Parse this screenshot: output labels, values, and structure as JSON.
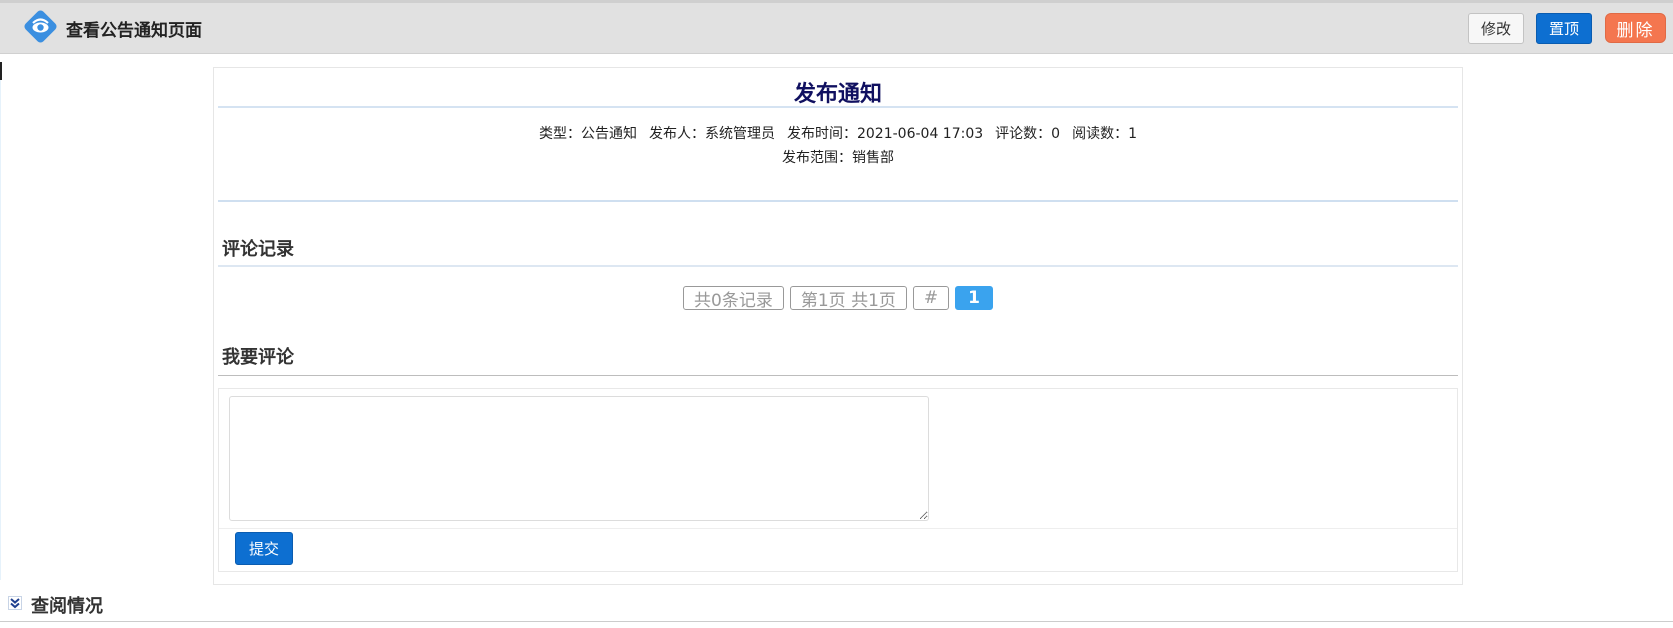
{
  "header": {
    "title": "查看公告通知页面",
    "edit_label": "修改",
    "pin_label": "置顶",
    "delete_label": "删除"
  },
  "notice": {
    "title": "发布通知",
    "type": "类型：公告通知",
    "publisher": "发布人：系统管理员",
    "publish_time": "发布时间：2021-06-04 17:03",
    "comment_count": "评论数：0",
    "read_count": "阅读数：1",
    "scope": "发布范围：销售部"
  },
  "comments": {
    "section_title": "评论记录",
    "pager": {
      "total": "共0条记录",
      "page_info": "第1页 共1页",
      "hash": "#",
      "current": "1"
    }
  },
  "comment_form": {
    "section_title": "我要评论",
    "textarea_value": "",
    "submit_label": "提交"
  },
  "read_status": {
    "section_title": "查阅情况"
  },
  "colors": {
    "primary": "#0d6fd1",
    "danger": "#f4764f",
    "pager_active": "#3aa3ee",
    "title_color": "#101060"
  }
}
